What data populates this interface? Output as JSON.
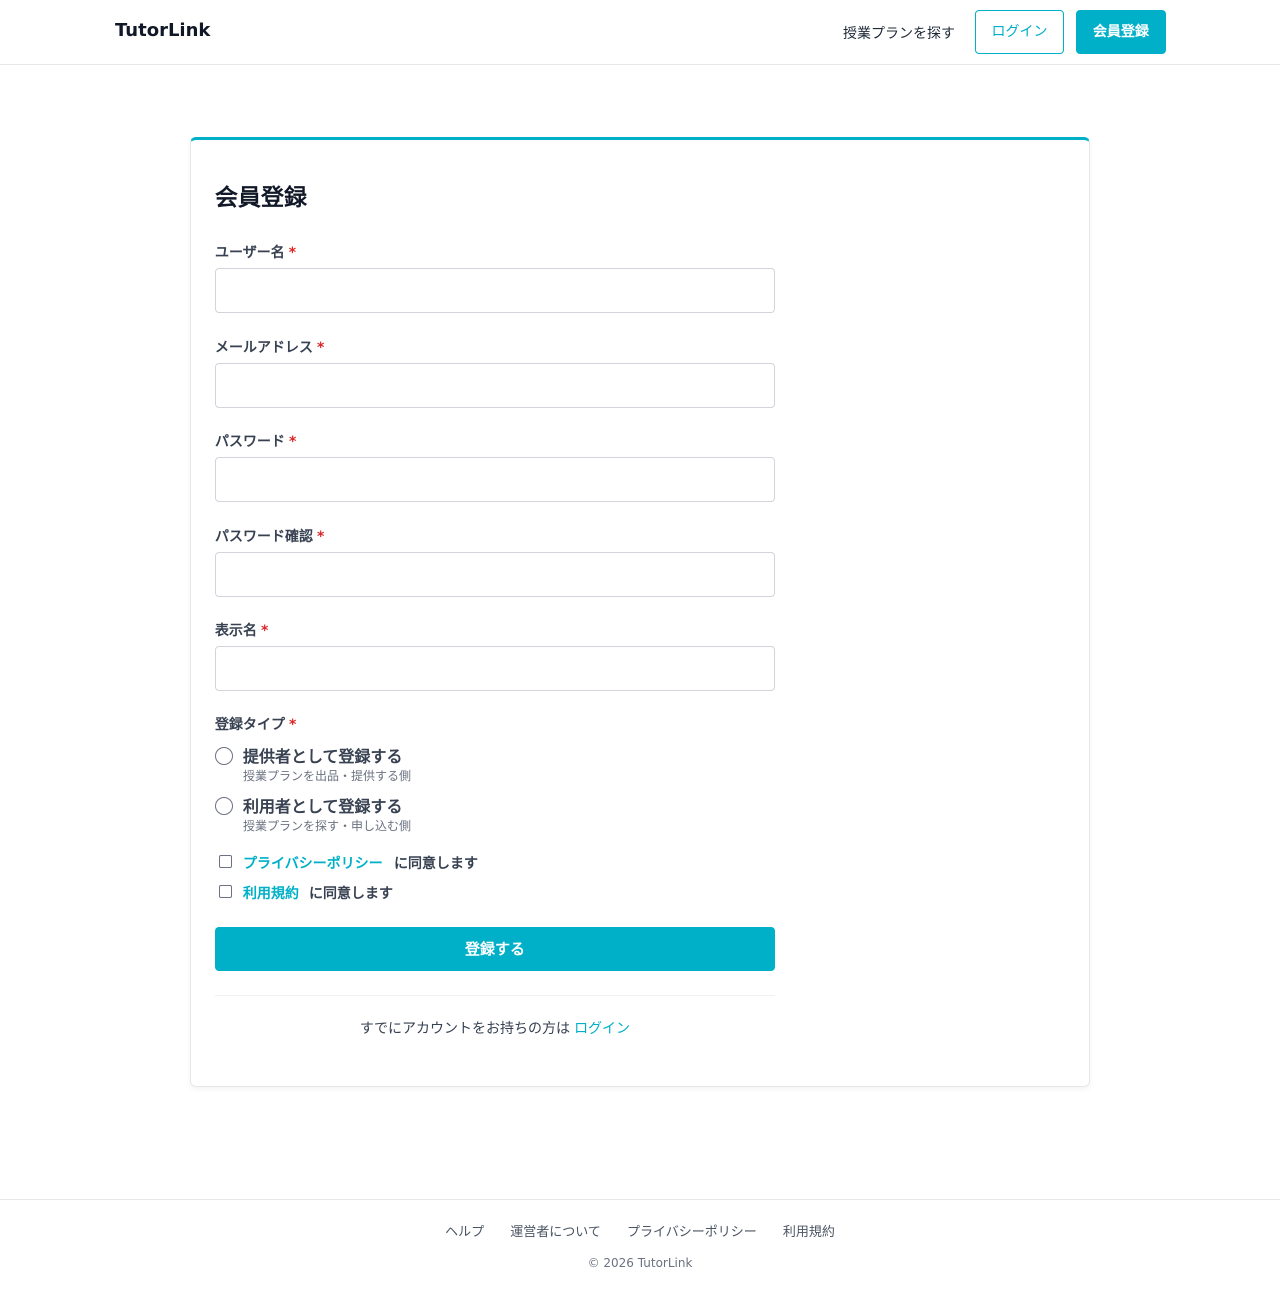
{
  "header": {
    "brand": "TutorLink",
    "nav_find_plans": "授業プランを探す",
    "login_button": "ログイン",
    "register_button": "会員登録"
  },
  "form": {
    "title": "会員登録",
    "required_mark": "*",
    "fields": [
      {
        "label": "ユーザー名",
        "value": ""
      },
      {
        "label": "メールアドレス",
        "value": ""
      },
      {
        "label": "パスワード",
        "value": ""
      },
      {
        "label": "パスワード確認",
        "value": ""
      },
      {
        "label": "表示名",
        "value": ""
      }
    ],
    "registration_type": {
      "label": "登録タイプ",
      "options": [
        {
          "title": "提供者として登録する",
          "description": "授業プランを出品・提供する側",
          "selected": false
        },
        {
          "title": "利用者として登録する",
          "description": "授業プランを探す・申し込む側",
          "selected": false
        }
      ]
    },
    "agreements": [
      {
        "link": "プライバシーポリシー",
        "text": "に同意します",
        "checked": false
      },
      {
        "link": "利用規約",
        "text": "に同意します",
        "checked": false
      }
    ],
    "submit_label": "登録する",
    "existing_account_text": "すでにアカウントをお持ちの方は",
    "existing_account_link": "ログイン"
  },
  "footer": {
    "links": [
      "ヘルプ",
      "運営者について",
      "プライバシーポリシー",
      "利用規約"
    ],
    "copyright": "© 2026 TutorLink"
  },
  "colors": {
    "accent": "#00b0c8",
    "required": "#dc2626"
  }
}
